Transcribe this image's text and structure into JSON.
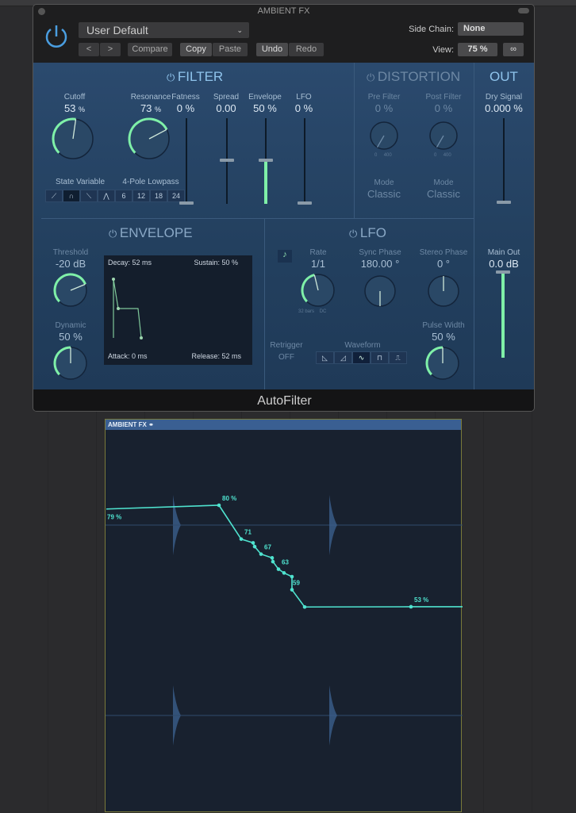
{
  "window": {
    "title": "AMBIENT FX",
    "footer": "AutoFilter"
  },
  "header": {
    "preset": "User Default",
    "compare": "Compare",
    "copy": "Copy",
    "paste": "Paste",
    "undo": "Undo",
    "redo": "Redo",
    "side_chain_label": "Side Chain:",
    "side_chain_value": "None",
    "view_label": "View:",
    "view_value": "75 %"
  },
  "filter": {
    "title": "FILTER",
    "cutoff": {
      "label": "Cutoff",
      "value": "53",
      "unit": "%",
      "level": 0.53
    },
    "resonance": {
      "label": "Resonance",
      "value": "73",
      "unit": "%",
      "level": 0.73
    },
    "mode_label": "State Variable",
    "slope_label": "4-Pole Lowpass",
    "slopes": [
      "6",
      "12",
      "18",
      "24"
    ],
    "sliders": [
      {
        "label": "Fatness",
        "value": "0 %",
        "level": 0
      },
      {
        "label": "Spread",
        "value": "0.00",
        "level": 0.5
      },
      {
        "label": "Envelope",
        "value": "50 %",
        "level": 0.5
      },
      {
        "label": "LFO",
        "value": "0 %",
        "level": 0
      }
    ]
  },
  "distortion": {
    "title": "DISTORTION",
    "pre": {
      "label": "Pre Filter",
      "value": "0 %",
      "min": "0",
      "max": "400"
    },
    "post": {
      "label": "Post Filter",
      "value": "0 %",
      "min": "0",
      "max": "400"
    },
    "mode_label": "Mode",
    "mode1": "Classic",
    "mode2": "Classic"
  },
  "out": {
    "title": "OUT",
    "dry_label": "Dry Signal",
    "dry_value": "0.000 %",
    "main_label": "Main Out",
    "main_value": "0.0 dB",
    "main_level": 1.0
  },
  "envelope": {
    "title": "ENVELOPE",
    "threshold": {
      "label": "Threshold",
      "value": "-20 dB",
      "level": 0.75
    },
    "dynamic": {
      "label": "Dynamic",
      "value": "50 %",
      "level": 0.5
    },
    "decay": "Decay: 52 ms",
    "sustain": "Sustain: 50 %",
    "attack": "Attack: 0 ms",
    "release": "Release: 52 ms"
  },
  "lfo": {
    "title": "LFO",
    "rate": {
      "label": "Rate",
      "value": "1/1",
      "min": "32 bars",
      "max": "DC",
      "level": 0.45
    },
    "sync_phase": {
      "label": "Sync Phase",
      "value": "180.00 °"
    },
    "stereo_phase": {
      "label": "Stereo Phase",
      "value": "0 °"
    },
    "pulse_width": {
      "label": "Pulse Width",
      "value": "50 %",
      "level": 0.5
    },
    "retrigger_label": "Retrigger",
    "retrigger_value": "OFF",
    "waveform_label": "Waveform"
  },
  "region": {
    "name": "AMBIENT FX",
    "automation": [
      {
        "value": 79,
        "label": "79 %"
      },
      {
        "value": 80,
        "label": "80 %"
      },
      {
        "value": 71,
        "label": "71"
      },
      {
        "value": 70
      },
      {
        "value": 69
      },
      {
        "value": 67,
        "label": "67"
      },
      {
        "value": 66
      },
      {
        "value": 65
      },
      {
        "value": 63,
        "label": "63"
      },
      {
        "value": 62
      },
      {
        "value": 61
      },
      {
        "value": 59,
        "label": "59"
      },
      {
        "value": 54
      },
      {
        "value": 53,
        "label": "53 %"
      },
      {
        "value": 53
      }
    ]
  },
  "colors": {
    "accent": "#7ff0a8",
    "automation": "#4fe3cf",
    "panel": "#2b4a6e"
  }
}
